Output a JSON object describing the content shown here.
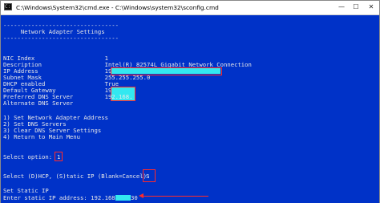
{
  "window": {
    "title": "C:\\Windows\\System32\\cmd.exe - C:\\Windows\\system32\\sconfig.cmd",
    "minimize_label": "—",
    "maximize_label": "☐",
    "close_label": "✕"
  },
  "console": {
    "lines": [
      "---------------------------------",
      "     Network Adapter Settings",
      "---------------------------------",
      "",
      "NIC Index                    1",
      "Description                  Intel(R) 82574L Gigabit Network Connection",
      "IP Address                   192.168.",
      "Subnet Mask                  255.255.255.0",
      "DHCP enabled                 True",
      "Default Gateway              192.168.",
      "Preferred DNS Server         192.168.",
      "Alternate DNS Server",
      "",
      "1) Set Network Adapter Address",
      "2) Set DNS Servers",
      "3) Clear DNS Server Settings",
      "4) Return to Main Menu",
      "",
      "Select option: ",
      "",
      "",
      "Select (D)HCP, (S)tatic IP (Blank=Cancel): ",
      "",
      "Set Static IP",
      "Enter static IP address: 192.168."
    ],
    "select_option_value": "1",
    "dhcp_static_value": "S",
    "static_ip_suffix": "30"
  },
  "colors": {
    "console_background": "#0032c8",
    "console_text": "#e8e8e8",
    "redaction_highlight": "#33e8f0",
    "annotation_red": "#ff2a2a"
  }
}
